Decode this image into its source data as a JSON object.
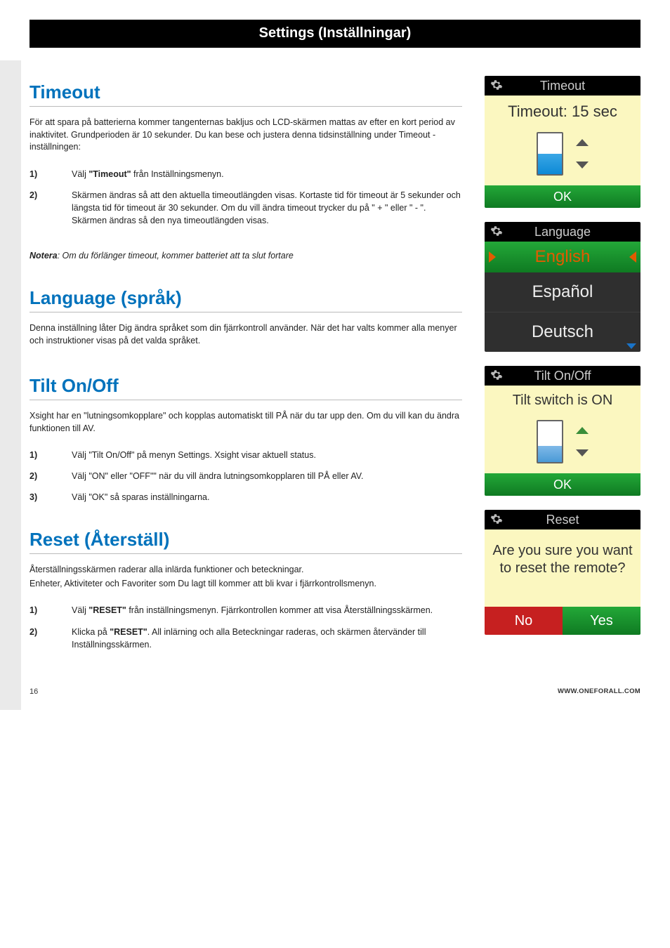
{
  "header": {
    "title": "Settings (Inställningar)"
  },
  "sections": {
    "timeout": {
      "heading": "Timeout",
      "intro": "För att spara på batterierna kommer tangenternas bakljus och LCD-skärmen mattas av efter en kort period av inaktivitet. Grundperioden är 10 sekunder. Du kan bese och justera denna tidsinställning under Timeout -inställningen:",
      "steps": {
        "s1_num": "1)",
        "s1_a": "Välj ",
        "s1_b": "\"Timeout\"",
        "s1_c": " från Inställningsmenyn.",
        "s2_num": "2)",
        "s2": "Skärmen ändras så att den aktuella timeoutlängden visas. Kortaste tid för timeout är 5 sekunder och längsta tid för timeout är 30 sekunder. Om du vill ändra timeout trycker du på \" + \" eller \" - \". Skärmen ändras så den nya timeoutlängden visas."
      },
      "note_label": "Notera",
      "note_text": ": Om du förlänger timeout, kommer batteriet att ta slut fortare"
    },
    "language": {
      "heading": "Language (språk)",
      "intro": "Denna inställning låter Dig ändra språket som din fjärrkontroll använder. När det har valts kommer alla menyer och instruktioner visas på det valda språket."
    },
    "tilt": {
      "heading": "Tilt On/Off",
      "intro": "Xsight har en \"lutningsomkopplare\" och kopplas automatiskt till PÅ när du tar upp den. Om du vill kan du ändra funktionen till AV.",
      "steps": {
        "s1_num": "1)",
        "s1": "Välj \"Tilt On/Off\" på menyn Settings. Xsight visar aktuell status.",
        "s2_num": "2)",
        "s2": "Välj \"ON\" eller \"OFF\"\" när du vill ändra lutningsomkopplaren till PÅ eller AV.",
        "s3_num": "3)",
        "s3": "Välj \"OK\" så sparas inställningarna."
      }
    },
    "reset": {
      "heading": "Reset (Återställ)",
      "intro1": "Återställningsskärmen raderar alla inlärda funktioner och beteckningar.",
      "intro2": "Enheter, Aktiviteter och Favoriter som Du lagt till kommer att bli kvar i fjärrkontrollsmenyn.",
      "steps": {
        "s1_num": "1)",
        "s1_a": "Välj ",
        "s1_b": "\"RESET\"",
        "s1_c": " från inställningsmenyn. Fjärrkontrollen kommer att visa Återställningsskärmen.",
        "s2_num": "2)",
        "s2_a": "Klicka på ",
        "s2_b": "\"RESET\"",
        "s2_c": ". All inlärning och alla Beteckningar raderas, och skärmen återvänder till Inställningsskärmen."
      }
    }
  },
  "panels": {
    "timeout": {
      "header": "Timeout",
      "status": "Timeout: 15 sec",
      "ok": "OK"
    },
    "language": {
      "header": "Language",
      "selected": "English",
      "opt1": "Español",
      "opt2": "Deutsch"
    },
    "tilt": {
      "header": "Tilt On/Off",
      "status": "Tilt switch is ON",
      "ok": "OK"
    },
    "reset": {
      "header": "Reset",
      "prompt": "Are you sure you want to reset the remote?",
      "no": "No",
      "yes": "Yes"
    }
  },
  "footer": {
    "page": "16",
    "url": "WWW.ONEFORALL.COM"
  }
}
